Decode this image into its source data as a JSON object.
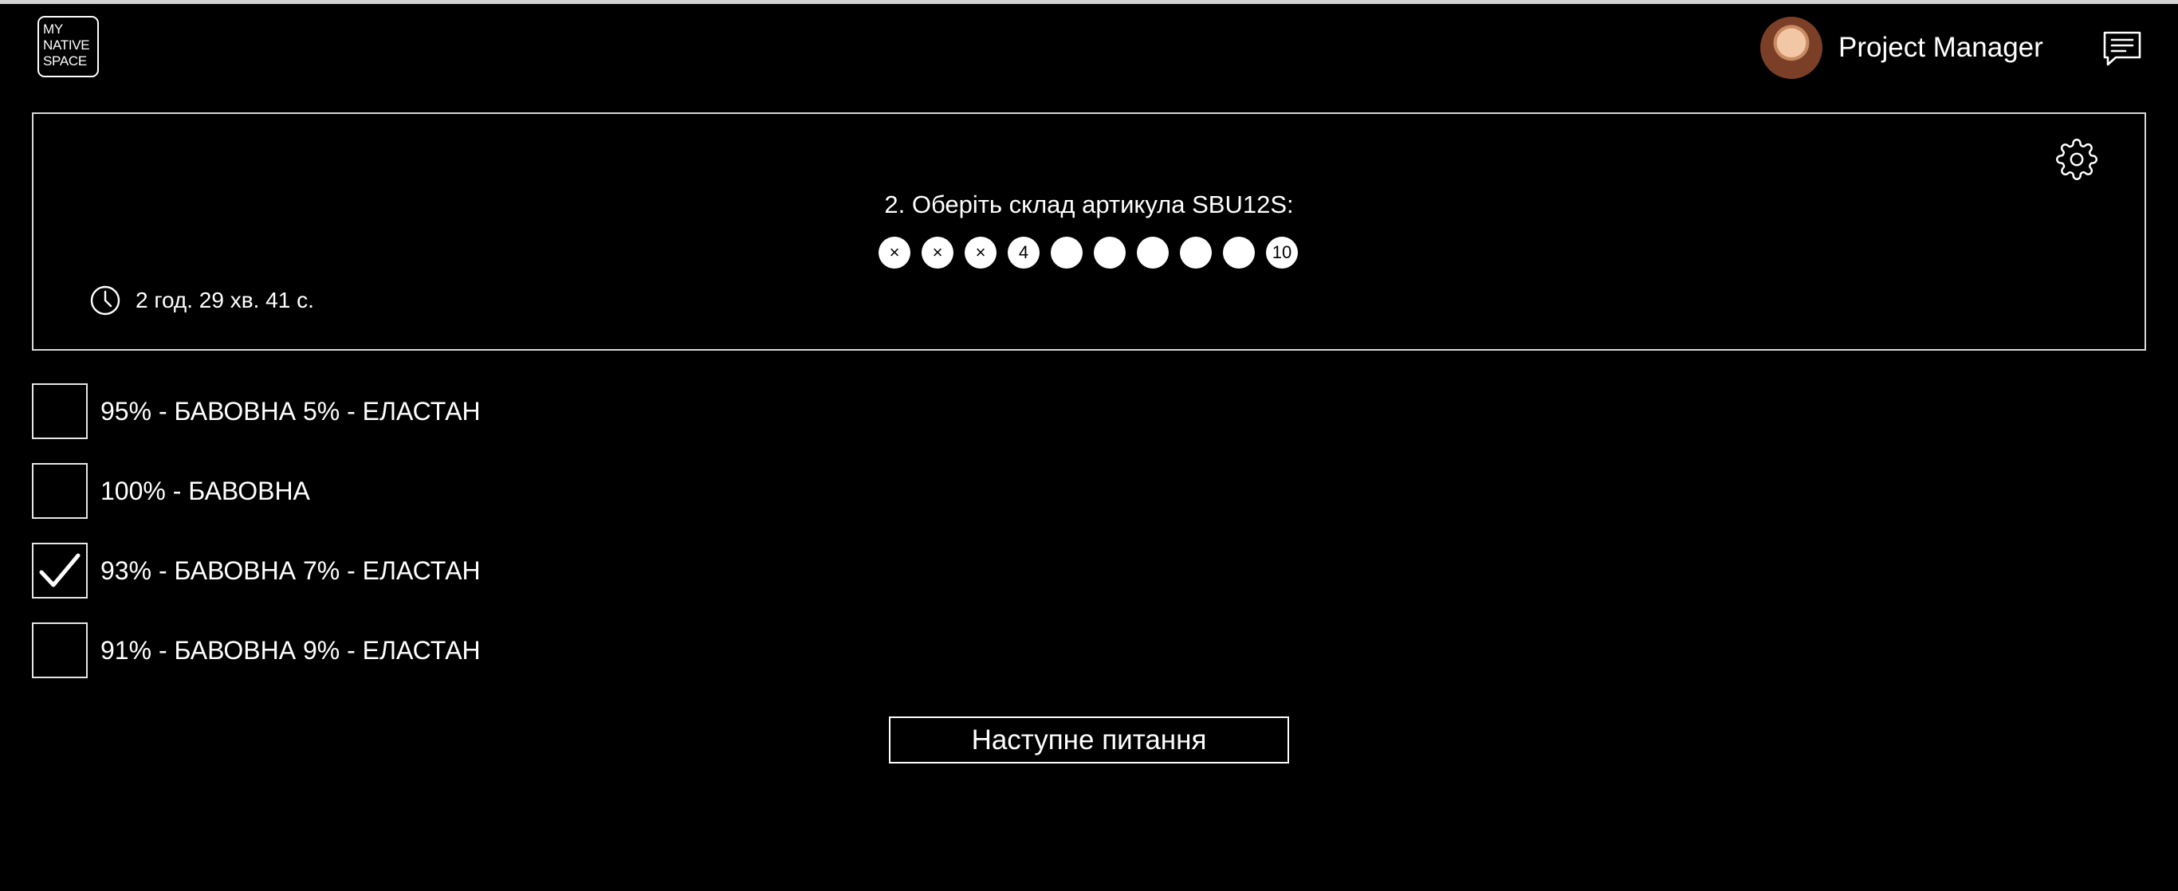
{
  "header": {
    "logo_lines": [
      "MY",
      "NATIVE",
      "SPACE"
    ],
    "user_role": "Project Manager",
    "icons": {
      "chat": "chat-list-icon",
      "settings": "gear-icon",
      "timer": "clock-icon"
    }
  },
  "question": {
    "text": "2. Оберіть склад артикула SBU12S:",
    "progress": [
      {
        "label": "×",
        "state": "answered"
      },
      {
        "label": "×",
        "state": "answered"
      },
      {
        "label": "×",
        "state": "answered"
      },
      {
        "label": "4",
        "state": "current"
      },
      {
        "label": "",
        "state": "pending"
      },
      {
        "label": "",
        "state": "pending"
      },
      {
        "label": "",
        "state": "pending"
      },
      {
        "label": "",
        "state": "pending"
      },
      {
        "label": "",
        "state": "pending"
      },
      {
        "label": "10",
        "state": "pending"
      }
    ],
    "timer": "2 год. 29 хв. 41 с."
  },
  "options": [
    {
      "label": "95% - БАВОВНА 5% - ЕЛАСТАН",
      "checked": false
    },
    {
      "label": "100% - БАВОВНА",
      "checked": false
    },
    {
      "label": "93% - БАВОВНА 7% - ЕЛАСТАН",
      "checked": true
    },
    {
      "label": "91% - БАВОВНА 9% - ЕЛАСТАН",
      "checked": false
    }
  ],
  "next_button": "Наступне питання",
  "colors": {
    "background": "#000000",
    "foreground": "#ffffff",
    "border": "#d8d8d8"
  }
}
